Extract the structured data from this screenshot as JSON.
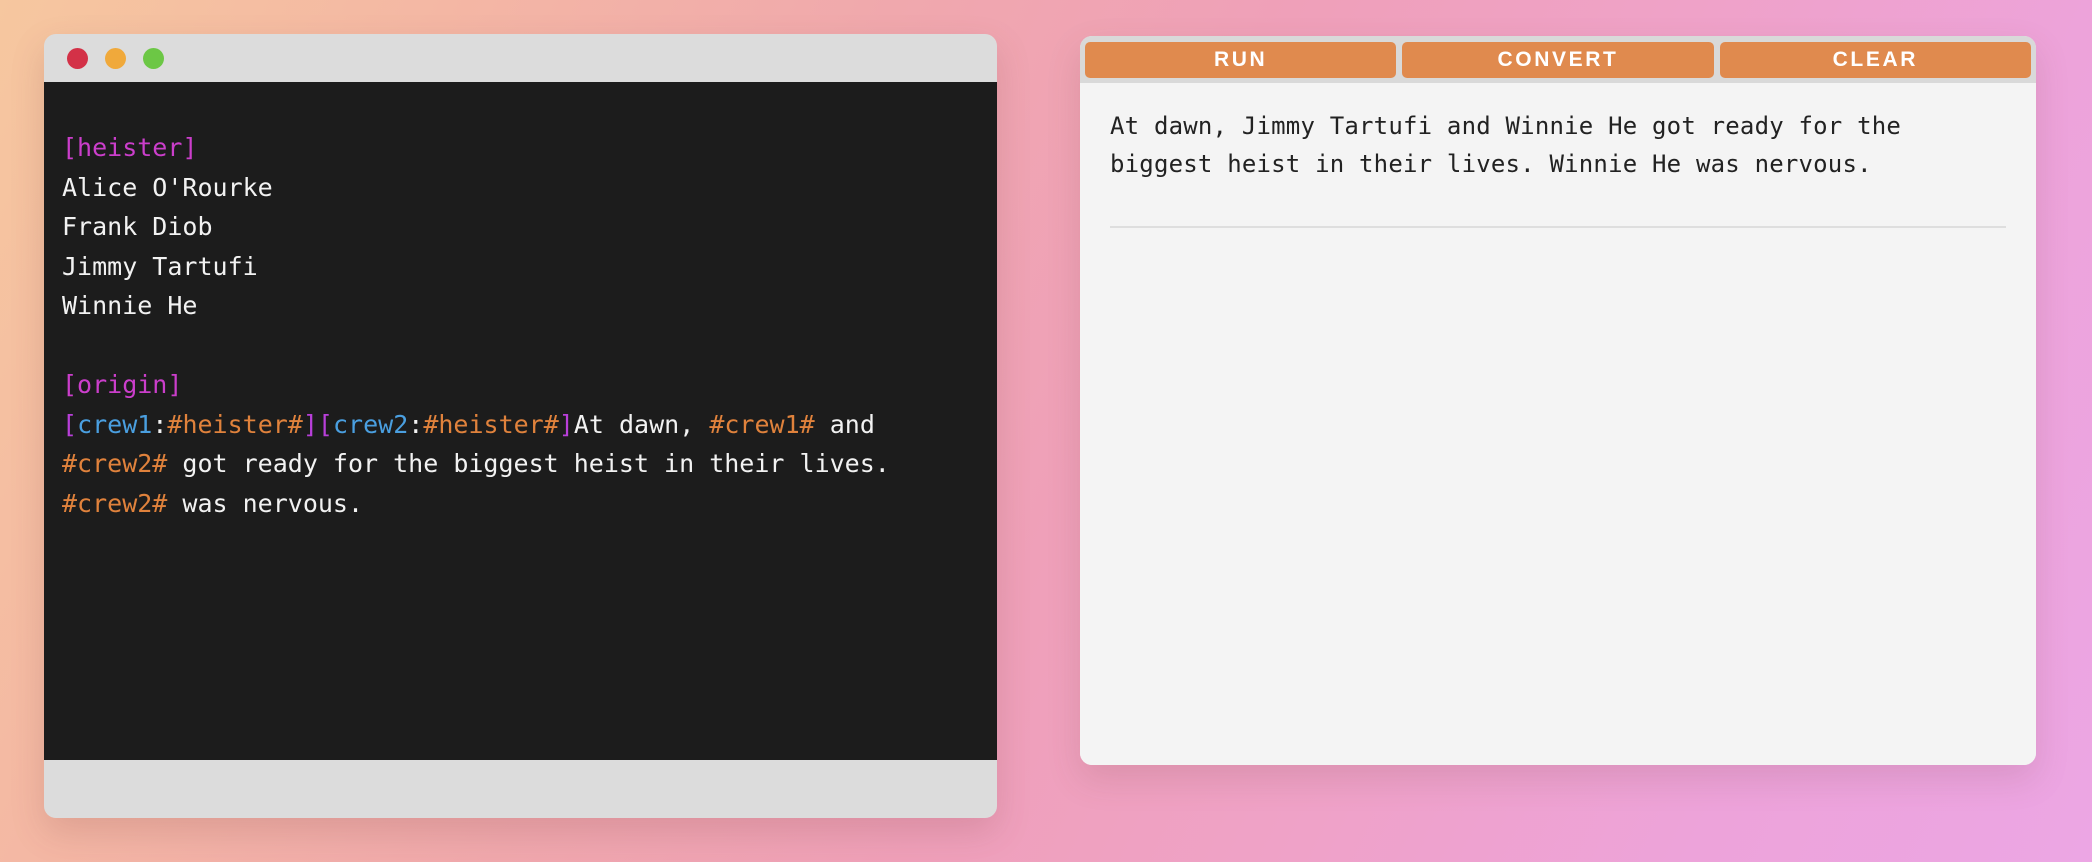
{
  "background": {
    "gradient_from": "#f6c79f",
    "gradient_to": "#eca6e4"
  },
  "editor_window": {
    "titlebar": {
      "close_color": "#d33147",
      "minimize_color": "#f0a93b",
      "maximize_color": "#6cc745"
    },
    "theme": {
      "background": "#1c1c1c",
      "foreground": "#f2f2f2",
      "section_color": "#cb3ecb",
      "bracket_color": "#b83fd9",
      "variable_color": "#4a9fe0",
      "reference_color": "#e0823c"
    },
    "source": {
      "section_heister": "[heister]",
      "heister_items": [
        "Alice O'Rourke",
        "Frank Diob",
        "Jimmy Tartufi",
        "Winnie He"
      ],
      "section_origin": "[origin]",
      "origin_tokens": {
        "open_bracket": "[",
        "crew1_name": "crew1",
        "colon": ":",
        "crew1_source": "#heister#",
        "close_bracket": "]",
        "crew2_name": "crew2",
        "crew2_source": "#heister#",
        "text_1": "At dawn, ",
        "ref_crew1": "#crew1#",
        "text_2": " and ",
        "ref_crew2_a": "#crew2#",
        "text_3": " got ready for the biggest heist in their lives. ",
        "ref_crew2_b": "#crew2#",
        "text_4": " was nervous."
      },
      "full_origin_line": "[crew1:#heister#][crew2:#heister#]At dawn, #crew1# and #crew2# got ready for the biggest heist in their lives. #crew2# was nervous."
    }
  },
  "output_panel": {
    "toolbar": {
      "run_label": "RUN",
      "convert_label": "CONVERT",
      "clear_label": "CLEAR",
      "button_color": "#e08a4e"
    },
    "result_text": "At dawn, Jimmy Tartufi and Winnie He got ready for the biggest heist in their lives. Winnie He was nervous."
  }
}
